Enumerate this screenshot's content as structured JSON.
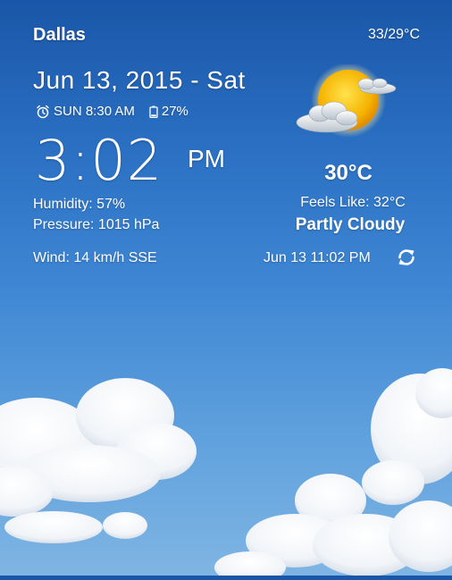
{
  "location": {
    "city": "Dallas",
    "hi_lo": "33/29°C"
  },
  "clock": {
    "date": "Jun 13, 2015 - Sat",
    "alarm": "SUN 8:30 AM",
    "battery": "27%",
    "time": "3:02",
    "ampm": "PM"
  },
  "details": {
    "humidity": "Humidity: 57%",
    "pressure": "Pressure: 1015 hPa",
    "wind": "Wind: 14 km/h SSE"
  },
  "weather": {
    "temp": "30°C",
    "feels_like": "Feels Like: 32°C",
    "condition": "Partly Cloudy",
    "updated": "Jun 13  11:02 PM",
    "icon": "partly-cloudy-icon"
  },
  "colors": {
    "sky_top": "#1a56a8",
    "sky_bottom": "#7fb5e3",
    "sun": "#f5b400"
  }
}
